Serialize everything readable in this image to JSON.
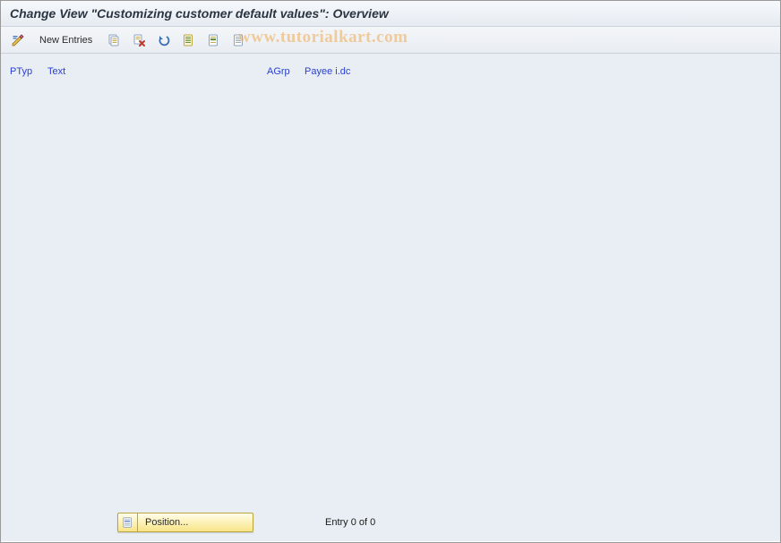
{
  "title": "Change View \"Customizing customer default values\": Overview",
  "toolbar": {
    "new_entries_label": "New Entries"
  },
  "watermark": "www.tutorialkart.com",
  "columns": {
    "ptyp": "PTyp",
    "text": "Text",
    "agrp": "AGrp",
    "payee": "Payee i.dc"
  },
  "footer": {
    "position_label": "Position...",
    "entry_count": "Entry 0 of 0"
  }
}
